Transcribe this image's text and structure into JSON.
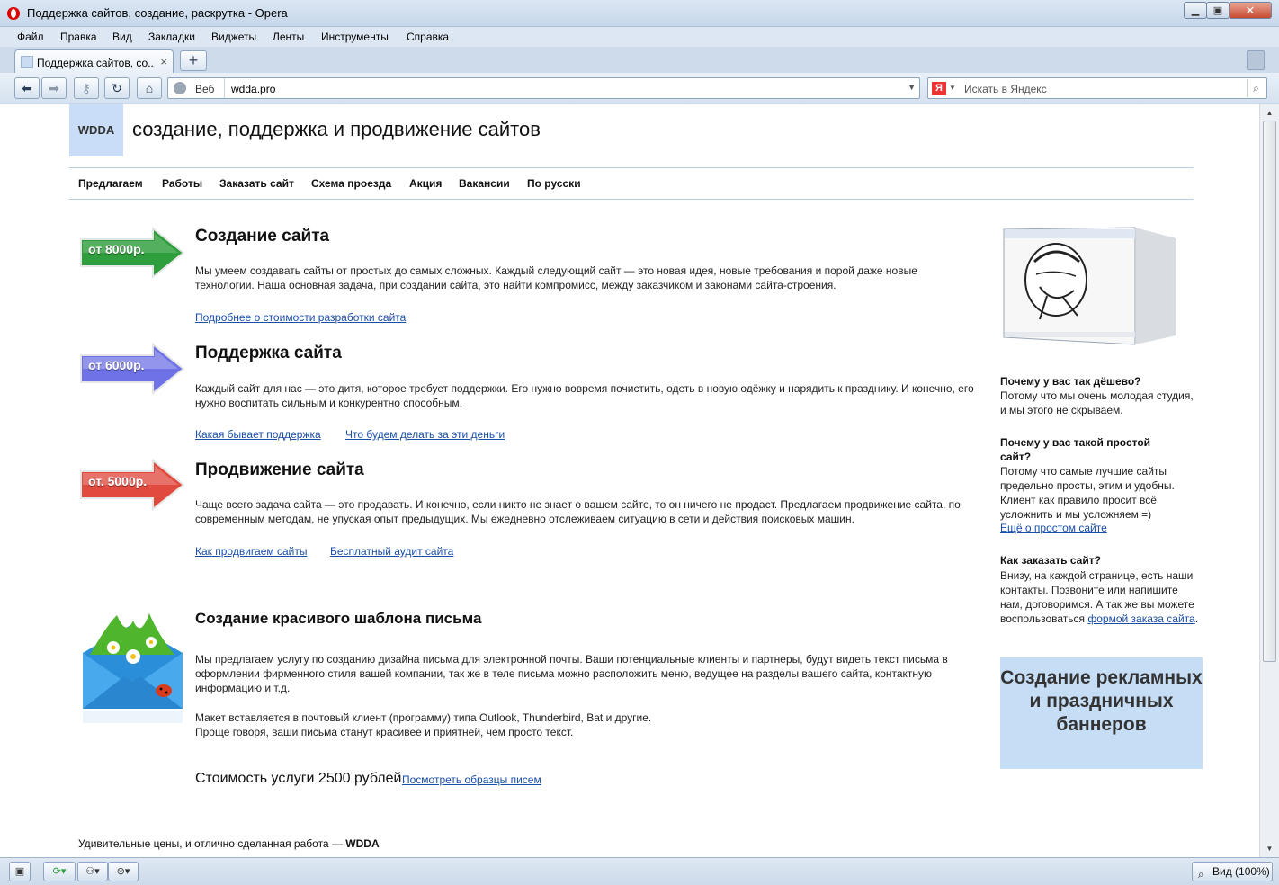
{
  "window": {
    "title": "Поддержка сайтов, создание, раскрутка - Opera",
    "minimize_icon": "minimize-icon",
    "maximize_icon": "maximize-icon",
    "close_icon": "close-icon"
  },
  "menu": [
    "Файл",
    "Правка",
    "Вид",
    "Закладки",
    "Виджеты",
    "Ленты",
    "Инструменты",
    "Справка"
  ],
  "tab": {
    "title": "Поддержка сайтов, со...",
    "close": "×",
    "new": "+"
  },
  "address": {
    "web_label": "Веб",
    "url": "wdda.pro"
  },
  "search": {
    "placeholder": "Искать в Яндекс",
    "engine_icon": "Я"
  },
  "site": {
    "logo": "WDDA",
    "tagline": "создание, поддержка и продвижение сайтов",
    "nav": [
      "Предлагаем",
      "Работы",
      "Заказать сайт",
      "Схема проезда",
      "Акция",
      "Вакансии",
      "По русски"
    ],
    "sections": [
      {
        "price": "от 8000р.",
        "title": "Создание сайта",
        "body": "Мы умеем создавать сайты от простых до самых сложных. Каждый следующий сайт — это новая идея, новые требования и порой даже новые технологии. Наша основная задача, при создании сайта, это найти компромисс, между заказчиком и законами сайта-строения.",
        "links": [
          "Подробнее о стоимости разработки сайта"
        ]
      },
      {
        "price": "от 6000р.",
        "title": "Поддержка сайта",
        "body": "Каждый сайт для нас — это дитя, которое требует поддержки. Его нужно вовремя почистить, одеть в новую одёжку и нарядить к празднику. И конечно, его нужно воспитать сильным и конкурентно способным.",
        "links": [
          "Какая бывает поддержка",
          "Что будем делать за эти деньги"
        ]
      },
      {
        "price": "от. 5000р.",
        "title": "Продвижение сайта",
        "body": "Чаще всего задача сайта — это продавать. И конечно, если никто не знает о вашем сайте, то он ничего не продаст. Предлагаем продвижение сайта, по современным методам, не упуская опыт предыдущих. Мы ежедневно отслеживаем ситуацию в сети и действия поисковых машин.",
        "links": [
          "Как продвигаем сайты",
          "Бесплатный аудит сайта"
        ]
      }
    ],
    "email_section": {
      "title": "Создание красивого шаблона письма",
      "body1": "Мы предлагаем услугу по созданию дизайна письма для электронной почты. Ваши потенциальные клиенты и партнеры, будут видеть текст письма в оформлении фирменного стиля вашей компании, так же в теле письма можно расположить меню, ведущее на разделы вашего сайта, контактную информацию и т.д.",
      "body2": "Макет вставляется в почтовый клиент (программу) типа Outlook, Thunderbird, Bat и другие.",
      "body3": "Проще говоря, ваши письма станут красивее и приятней, чем просто текст.",
      "price": "Стоимость услуги 2500 рублей.",
      "price_link": "Посмотреть образцы писем"
    },
    "footer": {
      "text": "Удивительные цены, и отлично сделанная работа — ",
      "brand": "WDDA"
    },
    "sidebar": {
      "q1": "Почему у вас так дёшево?",
      "a1": "Потому что мы очень молодая студия, и мы этого не скрываем.",
      "q2": "Почему у вас такой простой сайт?",
      "a2": "Потому что самые лучшие сайты предельно просты, этим и удобны. Клиент как правило просит всё усложнить и мы усложняем =)",
      "a2_link": "Ещё о простом сайте",
      "q3": "Как заказать сайт?",
      "a3": "Внизу, на каждой странице, есть наши контакты. Позвоните или напишите нам, договоримся. А так же вы можете воспользоваться ",
      "a3_link": "формой заказа сайта",
      "a3_end": ".",
      "banner": "Создание рекламных и праздничных баннеров"
    }
  },
  "statusbar": {
    "zoom": "Вид (100%)"
  },
  "colors": {
    "green_arrow": "#2f9e3c",
    "blue_arrow": "#6f72e6",
    "red_arrow": "#e14b3f",
    "link": "#1a4ea8",
    "banner_bg": "#c6ddf6"
  }
}
